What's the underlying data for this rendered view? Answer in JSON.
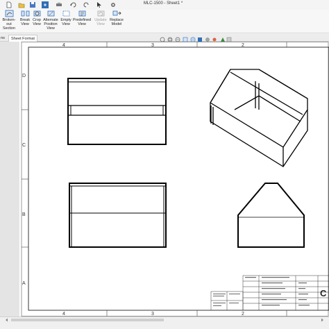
{
  "window": {
    "title": "MLC-1500 - Sheet1 *"
  },
  "ribbon": {
    "buttons": [
      {
        "label": "Broken-out Section",
        "line1": "Broken-out",
        "line2": "Section",
        "enabled": true
      },
      {
        "label": "Break View",
        "line1": "Break",
        "line2": "View",
        "enabled": true
      },
      {
        "label": "Crop View",
        "line1": "Crop",
        "line2": "View",
        "enabled": true
      },
      {
        "label": "Alternate Position View",
        "line1": "Alternate",
        "line2": "Position",
        "line3": "View",
        "enabled": true
      },
      {
        "label": "Empty View",
        "line1": "Empty",
        "line2": "View",
        "enabled": true
      },
      {
        "label": "Predefined View",
        "line1": "Predefined",
        "line2": "View",
        "enabled": true
      },
      {
        "label": "Update View",
        "line1": "Update",
        "line2": "View",
        "enabled": false
      },
      {
        "label": "Replace Model",
        "line1": "Replace",
        "line2": "Model",
        "enabled": true
      }
    ]
  },
  "tabs": [
    {
      "label": "ns",
      "active": false
    },
    {
      "label": "Sheet Format",
      "active": true
    }
  ],
  "sheet": {
    "zone_columns_top": [
      "4",
      "3",
      "2"
    ],
    "zone_columns_bottom": [
      "4",
      "3",
      "2"
    ],
    "zone_rows": [
      "D",
      "C",
      "B",
      "A"
    ],
    "title_block_letter": "C"
  },
  "colors": {
    "accent": "#2f6fb6",
    "sheet_border": "#333333"
  }
}
